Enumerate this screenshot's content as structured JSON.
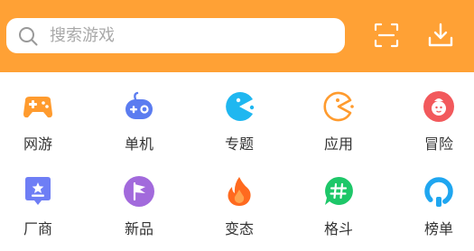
{
  "search": {
    "placeholder": "搜索游戏"
  },
  "header": {
    "scan_icon": "scan-icon",
    "download_icon": "download-icon"
  },
  "categories": {
    "row1": [
      {
        "label": "网游",
        "icon": "gamepad-icon",
        "color": "#FF9B2E"
      },
      {
        "label": "单机",
        "icon": "robot-controller-icon",
        "color": "#5B7CF0"
      },
      {
        "label": "专题",
        "icon": "pacman-icon",
        "color": "#1FB7F0"
      },
      {
        "label": "应用",
        "icon": "pacman-outline-icon",
        "color": "#FF9B2E"
      },
      {
        "label": "冒险",
        "icon": "adventure-character-icon",
        "color": "#F2595C"
      }
    ],
    "row2": [
      {
        "label": "厂商",
        "icon": "vendor-badge-icon",
        "color": "#6E7EF5"
      },
      {
        "label": "新品",
        "icon": "flag-icon",
        "color": "#A26ADC"
      },
      {
        "label": "变态",
        "icon": "flame-icon",
        "color": "#FF6A1F"
      },
      {
        "label": "格斗",
        "icon": "hashtag-chat-icon",
        "color": "#1EC769"
      },
      {
        "label": "榜单",
        "icon": "ranking-icon",
        "color": "#1FA6F0"
      }
    ]
  },
  "colors": {
    "header_bg": "#FFA135",
    "label_text": "#333333",
    "placeholder_text": "#A9A9A9"
  }
}
